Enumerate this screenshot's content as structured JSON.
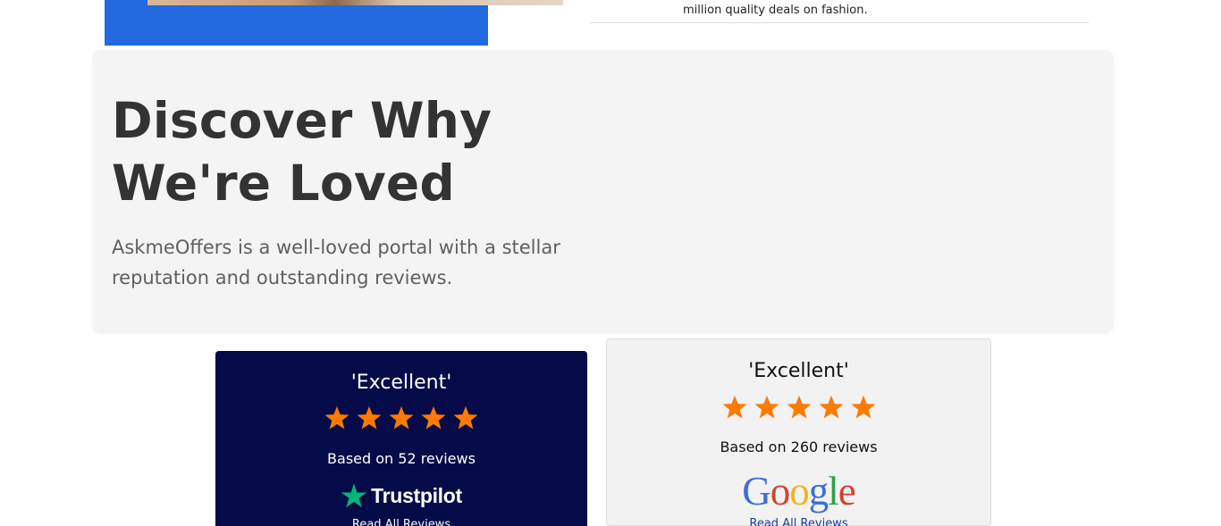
{
  "top_section": {
    "snippet_text": "million quality deals on fashion."
  },
  "loved_section": {
    "title_line1": "Discover Why",
    "title_line2": "We're Loved",
    "subtitle": "AskmeOffers is a well-loved portal with a stellar reputation and outstanding reviews."
  },
  "reviews": {
    "trustpilot": {
      "rating_label": "'Excellent'",
      "stars": 5,
      "based_on": "Based on 52 reviews",
      "brand": "Trustpilot",
      "link_label": "Read All Reviews",
      "star_color": "#ff7a00",
      "brand_star_color": "#00b67a",
      "background": "#040b48"
    },
    "google": {
      "rating_label": "'Excellent'",
      "stars": 5,
      "based_on": "Based on 260 reviews",
      "brand_letters": [
        "G",
        "o",
        "o",
        "g",
        "l",
        "e"
      ],
      "link_label": "Read All Reviews",
      "star_color": "#ff7a00",
      "background": "#f3f2f2"
    }
  },
  "colors": {
    "hero_blue": "#2369e0",
    "panel_bg": "#f4f4f4",
    "title_color": "#333333",
    "subtitle_color": "#606060"
  }
}
